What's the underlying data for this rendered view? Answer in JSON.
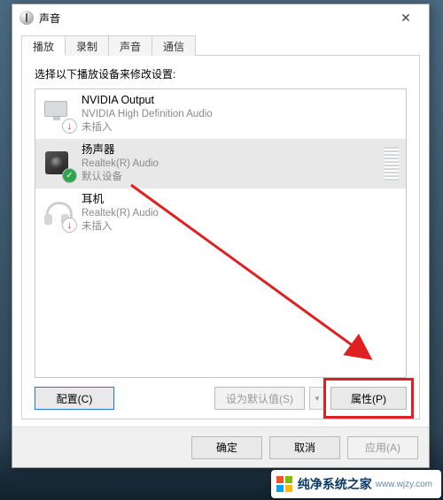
{
  "window": {
    "title": "声音",
    "close_glyph": "✕"
  },
  "tabs": [
    {
      "label": "播放",
      "active": true
    },
    {
      "label": "录制",
      "active": false
    },
    {
      "label": "声音",
      "active": false
    },
    {
      "label": "通信",
      "active": false
    }
  ],
  "prompt": "选择以下播放设备来修改设置:",
  "devices": [
    {
      "name": "NVIDIA Output",
      "sub": "NVIDIA High Definition Audio",
      "status": "未插入",
      "status_kind": "unplugged",
      "icon": "monitor",
      "selected": false,
      "has_vu": false
    },
    {
      "name": "扬声器",
      "sub": "Realtek(R) Audio",
      "status": "默认设备",
      "status_kind": "default",
      "icon": "speaker",
      "selected": true,
      "has_vu": true
    },
    {
      "name": "耳机",
      "sub": "Realtek(R) Audio",
      "status": "未插入",
      "status_kind": "unplugged",
      "icon": "headphones",
      "selected": false,
      "has_vu": false
    }
  ],
  "buttons": {
    "configure": "配置(C)",
    "set_default": "设为默认值(S)",
    "properties": "属性(P)",
    "ok": "确定",
    "cancel": "取消",
    "apply": "应用(A)"
  },
  "annotation": {
    "highlight_target": "properties",
    "arrow_color": "#e02020"
  },
  "watermark": {
    "text": "纯净系统之家",
    "url": "www.wjzy.com"
  }
}
